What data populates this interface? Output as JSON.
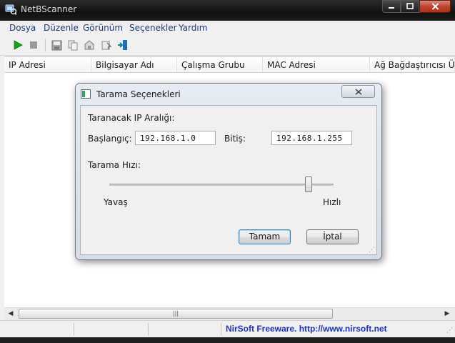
{
  "window": {
    "title": "NetBScanner",
    "controls": {
      "minimize": "minimize",
      "maximize": "maximize",
      "close": "close"
    }
  },
  "menu": [
    "Dosya",
    "Düzenle",
    "Görünüm",
    "Seçenekler",
    "Yardım"
  ],
  "toolbar": {
    "icons": [
      "play-icon",
      "stop-icon",
      "save-icon",
      "copy-icon",
      "properties-icon",
      "refresh-icon",
      "exit-icon"
    ]
  },
  "columns": [
    "IP Adresi",
    "Bilgisayar Adı",
    "Çalışma Grubu",
    "MAC Adresi",
    "Ağ Bağdaştırıcısı Üre"
  ],
  "scrollbar": {
    "position": 0.0
  },
  "status": {
    "link_text": "NirSoft Freeware.  http://www.nirsoft.net"
  },
  "dialog": {
    "title": "Tarama Seçenekleri",
    "range_label": "Taranacak IP Aralığı:",
    "start_label": "Başlangıç:",
    "start_value": "192.168.1.0",
    "end_label": "Bitiş:",
    "end_value": "192.168.1.255",
    "speed_label": "Tarama Hızı:",
    "slow_label": "Yavaş",
    "fast_label": "Hızlı",
    "speed_fraction": 0.9,
    "ok_label": "Tamam",
    "cancel_label": "İptal"
  },
  "colors": {
    "menu_text": "#1e3a78",
    "status_link": "#1b33c4",
    "play": "#1aa31a"
  }
}
